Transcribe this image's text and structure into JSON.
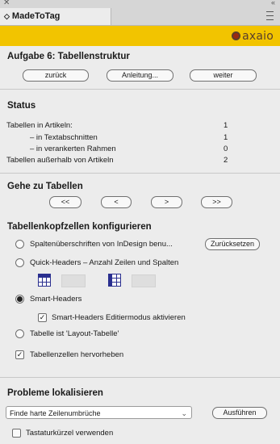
{
  "panel": {
    "tab_title": "MadeToTag",
    "tab_arrows": "◇"
  },
  "brand": {
    "logo_text": "axaio",
    "color": "#f2c400"
  },
  "task": {
    "title": "Aufgabe 6: Tabellenstruktur",
    "buttons": {
      "back": "zurück",
      "guide": "Anleitung...",
      "next": "weiter"
    }
  },
  "status": {
    "heading": "Status",
    "rows": [
      {
        "label": "Tabellen in Artikeln:",
        "value": "1"
      },
      {
        "label": "– in Textabschnitten",
        "value": "1"
      },
      {
        "label": "– in verankerten Rahmen",
        "value": "0"
      },
      {
        "label": "Tabellen außerhalb von Artikeln",
        "value": "2"
      }
    ]
  },
  "goto": {
    "heading": "Gehe zu Tabellen",
    "buttons": {
      "first": "<<",
      "prev": "<",
      "next": ">",
      "last": ">>"
    }
  },
  "headers": {
    "heading": "Tabellenkopfzellen konfigurieren",
    "opt_columns": "Spaltenüberschriften von InDesign benu...",
    "reset": "Zurücksetzen",
    "opt_quick": "Quick-Headers – Anzahl Zeilen und Spalten",
    "opt_smart": "Smart-Headers",
    "smart_edit": "Smart-Headers Editiermodus aktivieren",
    "opt_layout": "Tabelle ist 'Layout-Tabelle'",
    "highlight": "Tabellenzellen hervorheben"
  },
  "problems": {
    "heading": "Probleme lokalisieren",
    "select_value": "Finde harte Zeilenumbrüche",
    "run": "Ausführen",
    "shortcuts": "Tastaturkürzel verwenden"
  }
}
